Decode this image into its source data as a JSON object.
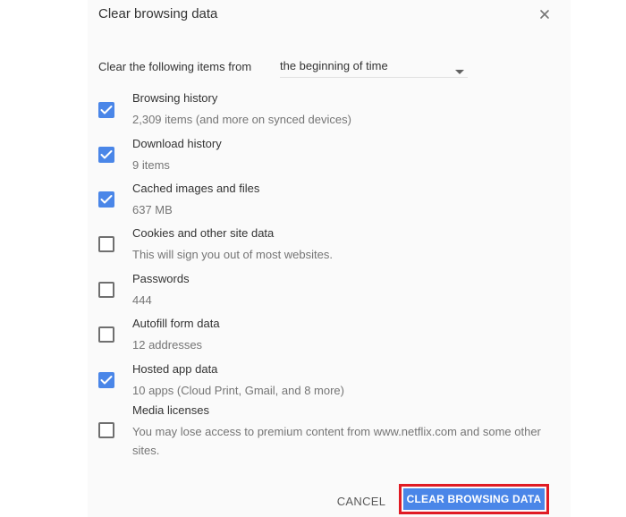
{
  "dialog": {
    "title": "Clear browsing data",
    "close_icon": "close-icon"
  },
  "range": {
    "label": "Clear the following items from",
    "value": "the beginning of time",
    "caret_icon": "dropdown-caret-icon"
  },
  "items": [
    {
      "label": "Browsing history",
      "desc": "2,309 items (and more on synced devices)",
      "checked": true
    },
    {
      "label": "Download history",
      "desc": "9 items",
      "checked": true
    },
    {
      "label": "Cached images and files",
      "desc": "637 MB",
      "checked": true
    },
    {
      "label": "Cookies and other site data",
      "desc": "This will sign you out of most websites.",
      "checked": false
    },
    {
      "label": "Passwords",
      "desc": "444",
      "checked": false
    },
    {
      "label": "Autofill form data",
      "desc": "12 addresses",
      "checked": false
    },
    {
      "label": "Hosted app data",
      "desc": "10 apps (Cloud Print, Gmail, and 8 more)",
      "checked": true
    },
    {
      "label": "Media licenses",
      "desc": "You may lose access to premium content from www.netflix.com and some other sites.",
      "checked": false
    }
  ],
  "buttons": {
    "cancel": "CANCEL",
    "clear": "CLEAR BROWSING DATA"
  },
  "colors": {
    "accent": "#4a86e8",
    "highlight_outline": "#e01b24"
  }
}
